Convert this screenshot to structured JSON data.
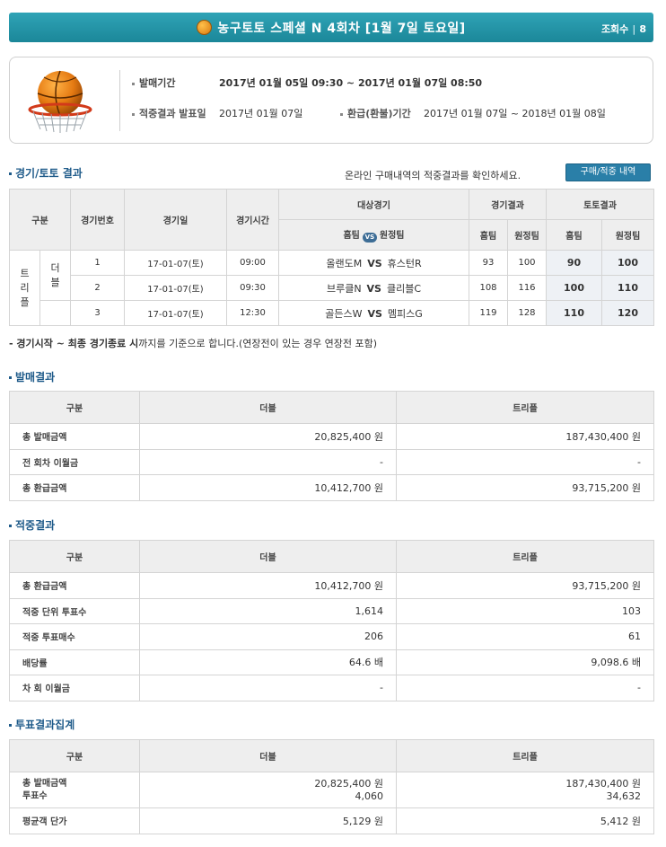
{
  "header": {
    "title": "농구토토 스페셜 N 4회차 [1월 7일 토요일]",
    "view_label": "조회수",
    "view_count": "8"
  },
  "info": {
    "sale_label": "발매기간",
    "sale_value": "2017년 01월 05일 09:30 ~ 2017년 01월 07일 08:50",
    "result_label": "적중결과 발표일",
    "result_value": "2017년 01월 07일",
    "refund_label": "환급(환불)기간",
    "refund_value": "2017년 01월 07일 ~ 2018년 01월 08일"
  },
  "match_section": {
    "title": "경기/토토 결과",
    "notice": "온라인 구매내역의 적중결과를 확인하세요.",
    "button": "구매/적중 내역",
    "headers": {
      "type": "구분",
      "no": "경기번호",
      "date": "경기일",
      "time": "경기시간",
      "game": "대상경기",
      "game_result": "경기결과",
      "toto_result": "토토결과",
      "home": "홈팀",
      "vs": "VS",
      "away": "원정팀"
    },
    "cat1": "트리플",
    "cat2": "더블",
    "rows": [
      {
        "no": "1",
        "date": "17-01-07(토)",
        "time": "09:00",
        "home": "올랜도M",
        "vs": "VS",
        "away": "휴스턴R",
        "gh": "93",
        "ga": "100",
        "th": "90",
        "ta": "100"
      },
      {
        "no": "2",
        "date": "17-01-07(토)",
        "time": "09:30",
        "home": "브루클N",
        "vs": "VS",
        "away": "클리블C",
        "gh": "108",
        "ga": "116",
        "th": "100",
        "ta": "110"
      },
      {
        "no": "3",
        "date": "17-01-07(토)",
        "time": "12:30",
        "home": "골든스W",
        "vs": "VS",
        "away": "멤피스G",
        "gh": "119",
        "ga": "128",
        "th": "110",
        "ta": "120"
      }
    ],
    "footnote_bold": "- 경기시작 ~ 최종 경기종료 시",
    "footnote_rest": "까지를 기준으로 합니다.(연장전이 있는 경우 연장전 포함)"
  },
  "sales_section": {
    "title": "발매결과",
    "col_type": "구분",
    "col_double": "더블",
    "col_triple": "트리플",
    "rows": [
      {
        "label": "총 발매금액",
        "double": "20,825,400 원",
        "triple": "187,430,400 원"
      },
      {
        "label": "전 회차 이월금",
        "double": "-",
        "triple": "-"
      },
      {
        "label": "총 환급금액",
        "double": "10,412,700 원",
        "triple": "93,715,200 원"
      }
    ]
  },
  "hit_section": {
    "title": "적중결과",
    "col_type": "구분",
    "col_double": "더블",
    "col_triple": "트리플",
    "rows": [
      {
        "label": "총 환급금액",
        "double": "10,412,700 원",
        "triple": "93,715,200 원"
      },
      {
        "label": "적중 단위 투표수",
        "double": "1,614",
        "triple": "103"
      },
      {
        "label": "적중 투표매수",
        "double": "206",
        "triple": "61"
      },
      {
        "label": "배당률",
        "double": "64.6 배",
        "triple": "9,098.6 배"
      },
      {
        "label": "차 회 이월금",
        "double": "-",
        "triple": "-"
      }
    ]
  },
  "vote_section": {
    "title": "투표결과집계",
    "col_type": "구분",
    "col_double": "더블",
    "col_triple": "트리플",
    "row1_label_a": "총 발매금액",
    "row1_label_b": "투표수",
    "row1_double_a": "20,825,400 원",
    "row1_double_b": "4,060",
    "row1_triple_a": "187,430,400 원",
    "row1_triple_b": "34,632",
    "row2_label": "평균객 단가",
    "row2_double": "5,129 원",
    "row2_triple": "5,412 원"
  }
}
